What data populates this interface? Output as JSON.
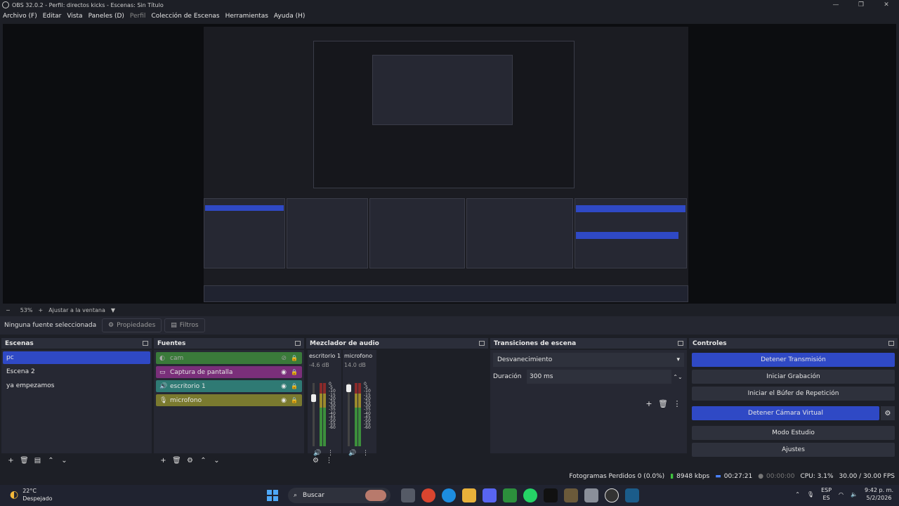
{
  "window": {
    "title": "OBS 32.0.2 - Perfil: directos kicks - Escenas: Sin Título",
    "controls": [
      "—",
      "❐",
      "✕"
    ]
  },
  "menu": {
    "items": [
      "Archivo (F)",
      "Editar",
      "Vista",
      "Paneles (D)",
      "Perfil",
      "Colección de Escenas",
      "Herramientas",
      "Ayuda (H)"
    ]
  },
  "zoom": {
    "minus": "−",
    "value": "53%",
    "plus": "+",
    "fit": "Ajustar a la ventana"
  },
  "source_bar": {
    "selection": "Ninguna fuente seleccionada",
    "properties": "Propiedades",
    "filters": "Filtros"
  },
  "scenes": {
    "title": "Escenas",
    "items": [
      "pc",
      "Escena 2",
      "ya empezamos"
    ]
  },
  "sources": {
    "title": "Fuentes",
    "items": [
      {
        "label": "cam",
        "color": "#3a7a3a"
      },
      {
        "label": "Captura de pantalla",
        "color": "#7a2f7a"
      },
      {
        "label": "escritorio 1",
        "color": "#2f7a74"
      },
      {
        "label": "microfono",
        "color": "#7a7a2f"
      }
    ]
  },
  "mixer": {
    "title": "Mezclador de audio",
    "channels": [
      {
        "name": "escritorio 1",
        "db": "-4.6 dB",
        "level": 0.8
      },
      {
        "name": "microfono",
        "db": "14.0 dB",
        "level": 0.8
      }
    ],
    "ticks": [
      "0",
      "-5",
      "-10",
      "-15",
      "-20",
      "-25",
      "-30",
      "-35",
      "-40",
      "-45",
      "-50",
      "-55",
      "-60"
    ]
  },
  "transitions": {
    "title": "Transiciones de escena",
    "selected": "Desvanecimiento",
    "duration_label": "Duración",
    "duration_value": "300 ms"
  },
  "controls": {
    "title": "Controles",
    "stop_stream": "Detener Transmisión",
    "start_recording": "Iniciar Grabación",
    "replay_buffer": "Iniciar el Búfer de Repetición",
    "stop_virtual_cam": "Detener Cámara Virtual",
    "studio_mode": "Modo Estudio",
    "settings": "Ajustes"
  },
  "status": {
    "dropped": "Fotogramas Perdidos 0 (0.0%)",
    "bitrate": "8948 kbps",
    "stream_time": "00:27:21",
    "rec_time": "00:00:00",
    "cpu": "CPU: 3.1%",
    "fps": "30.00 / 30.00 FPS"
  },
  "taskbar": {
    "temp": "22°C",
    "weather": "Despejado",
    "search": "Buscar",
    "lang_top": "ESP",
    "lang_bottom": "ES",
    "time": "9:42 p. m.",
    "date": "5/2/2026"
  }
}
